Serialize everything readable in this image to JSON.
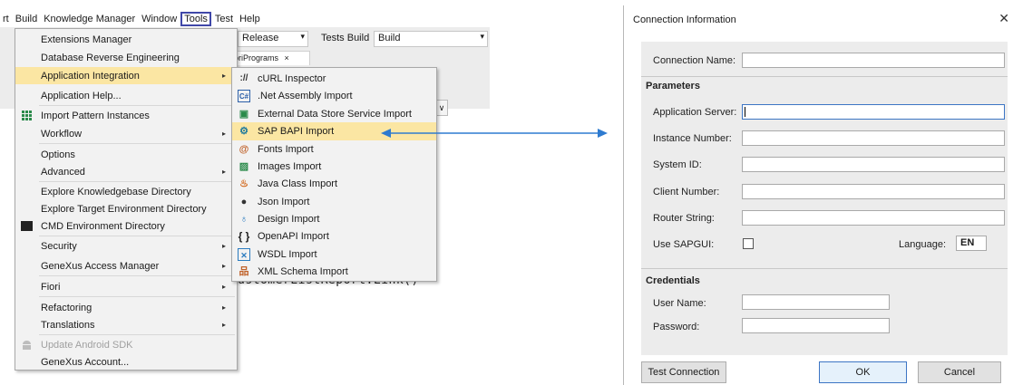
{
  "menubar": {
    "items": [
      "rt",
      "Build",
      "Knowledge Manager",
      "Window",
      "Tools",
      "Test",
      "Help"
    ],
    "active": "Tools"
  },
  "toolbar": {
    "config_value": "Release",
    "tests_label": "Tests Build",
    "build_value": "Build"
  },
  "editor": {
    "tab_label": "tFioriPrograms",
    "tab_close": "×",
    "code_line": "ustomerListReport.Link()",
    "scroll_glyph": "∨"
  },
  "tools_menu": {
    "items": [
      {
        "label": "Extensions Manager"
      },
      {
        "label": "Database Reverse Engineering"
      },
      {
        "label": "Application Integration",
        "arrow": "▸"
      },
      {
        "label": "Application Help..."
      },
      {
        "label": "Import Pattern Instances"
      },
      {
        "label": "Workflow",
        "arrow": "▸"
      },
      {
        "label": "Options"
      },
      {
        "label": "Advanced",
        "arrow": "▸"
      },
      {
        "label": "Explore Knowledgebase Directory"
      },
      {
        "label": "Explore Target Environment Directory"
      },
      {
        "label": "CMD Environment Directory"
      },
      {
        "label": "Security",
        "arrow": "▸"
      },
      {
        "label": "GeneXus Access Manager",
        "arrow": "▸"
      },
      {
        "label": "Fiori",
        "arrow": "▸"
      },
      {
        "label": "Refactoring",
        "arrow": "▸"
      },
      {
        "label": "Translations",
        "arrow": "▸"
      },
      {
        "label": "Update Android SDK"
      },
      {
        "label": "GeneXus Account..."
      }
    ]
  },
  "integration_submenu": {
    "items": [
      {
        "label": "cURL Inspector",
        "icon": "curl-icon",
        "glyph": "://"
      },
      {
        "label": ".Net Assembly Import",
        "icon": "csharp-icon",
        "glyph": "C#"
      },
      {
        "label": "External Data Store Service Import",
        "icon": "datastore-icon",
        "glyph": "▣"
      },
      {
        "label": "SAP BAPI Import",
        "icon": "sap-bapi-icon",
        "glyph": "⚙"
      },
      {
        "label": "Fonts Import",
        "icon": "fonts-icon",
        "glyph": "@"
      },
      {
        "label": "Images Import",
        "icon": "images-icon",
        "glyph": "▨"
      },
      {
        "label": "Java Class Import",
        "icon": "java-icon",
        "glyph": "♨"
      },
      {
        "label": "Json Import",
        "icon": "json-icon",
        "glyph": "●"
      },
      {
        "label": "Design Import",
        "icon": "design-icon",
        "glyph": "♁"
      },
      {
        "label": "OpenAPI Import",
        "icon": "openapi-icon",
        "glyph": "{ }"
      },
      {
        "label": "WSDL Import",
        "icon": "wsdl-icon",
        "glyph": "✕"
      },
      {
        "label": "XML Schema Import",
        "icon": "xml-schema-icon",
        "glyph": "品"
      }
    ]
  },
  "dialog": {
    "title": "Connection Information",
    "close": "✕",
    "connection_name_label": "Connection Name:",
    "connection_name_value": "",
    "parameters_heading": "Parameters",
    "application_server_label": "Application Server:",
    "instance_number_label": "Instance Number:",
    "system_id_label": "System ID:",
    "client_number_label": "Client Number:",
    "router_string_label": "Router String:",
    "use_sapgui_label": "Use SAPGUI:",
    "use_sapgui_checked": false,
    "language_label": "Language:",
    "language_value": "EN",
    "credentials_heading": "Credentials",
    "user_name_label": "User Name:",
    "password_label": "Password:",
    "test_connection_label": "Test Connection",
    "ok_label": "OK",
    "cancel_label": "Cancel"
  },
  "colors": {
    "menu_highlight": "#fbe6a3",
    "active_menu_border": "#3f47a8",
    "arrow": "#2e7bd0",
    "focus_border": "#3c75c4"
  }
}
